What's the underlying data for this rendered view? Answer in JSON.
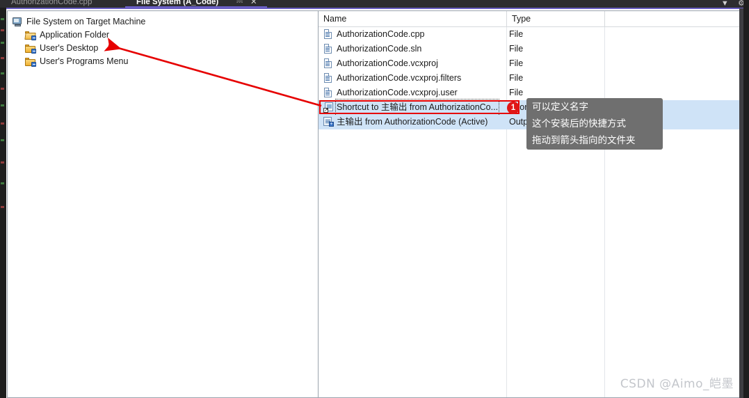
{
  "window": {
    "tabs": [
      {
        "label": "AuthorizationCode.cpp",
        "active": false
      },
      {
        "label": "File System (A_Code)",
        "active": true
      }
    ],
    "pin_icon": "pin-icon",
    "close_icon": "close-icon",
    "chevron_icon": "chevron-down-icon",
    "gear_icon": "gear-icon",
    "accent_color": "#6a5fc4"
  },
  "tree": {
    "root": {
      "label": "File System on Target Machine",
      "icon": "monitor-icon"
    },
    "items": [
      {
        "label": "Application Folder",
        "icon": "folder-open-shortcut-icon"
      },
      {
        "label": "User's Desktop",
        "icon": "folder-shortcut-icon"
      },
      {
        "label": "User's Programs Menu",
        "icon": "folder-shortcut-icon"
      }
    ]
  },
  "list": {
    "columns": [
      {
        "label": "Name"
      },
      {
        "label": "Type"
      }
    ],
    "rows": [
      {
        "name": "AuthorizationCode.cpp",
        "type": "File",
        "icon": "file-icon",
        "selected": false
      },
      {
        "name": "AuthorizationCode.sln",
        "type": "File",
        "icon": "file-icon",
        "selected": false
      },
      {
        "name": "AuthorizationCode.vcxproj",
        "type": "File",
        "icon": "file-icon",
        "selected": false
      },
      {
        "name": "AuthorizationCode.vcxproj.filters",
        "type": "File",
        "icon": "file-icon",
        "selected": false
      },
      {
        "name": "AuthorizationCode.vcxproj.user",
        "type": "File",
        "icon": "file-icon",
        "selected": false
      },
      {
        "name": "Shortcut to 主输出 from AuthorizationCo...",
        "type": "Shortcut",
        "icon": "shortcut-icon",
        "selected": true
      },
      {
        "name": "主输出 from AuthorizationCode (Active)",
        "type": "Output",
        "icon": "output-icon",
        "selected": true
      }
    ]
  },
  "annotations": {
    "badge_number": "1",
    "badge_color": "#e01616",
    "callout_color": "#e60000",
    "tooltip_lines": [
      "可以定义名字",
      "这个安装后的快捷方式",
      "拖动到箭头指向的文件夹"
    ],
    "tooltip_bg": "#6f6f6f"
  },
  "watermark": {
    "text": "CSDN @Aimo_皑墨"
  }
}
